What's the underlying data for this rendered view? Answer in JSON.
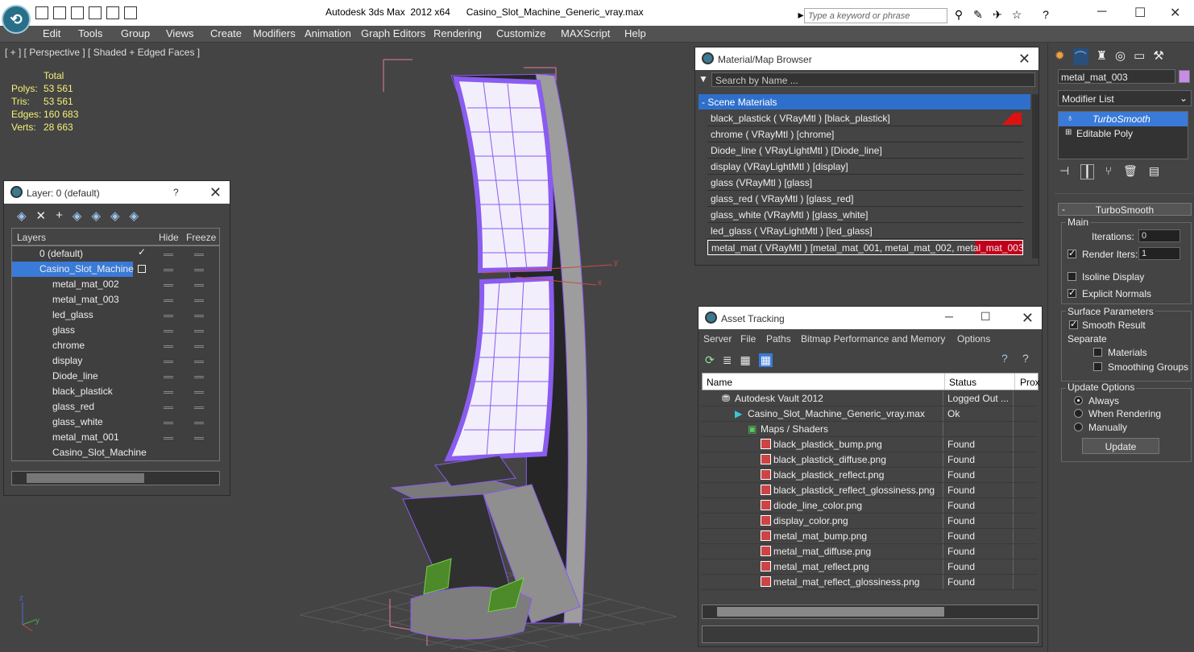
{
  "window": {
    "title": "Autodesk 3ds Max  2012 x64      Casino_Slot_Machine_Generic_vray.max",
    "search_placeholder": "Type a keyword or phrase",
    "logo": "3ds max logo-icon"
  },
  "menu": [
    "Edit",
    "Tools",
    "Group",
    "Views",
    "Create",
    "Modifiers",
    "Animation",
    "Graph Editors",
    "Rendering",
    "Customize",
    "MAXScript",
    "Help"
  ],
  "viewport": {
    "label": "[ + ] [ Perspective ] [ Shaded + Edged Faces ]",
    "stats": {
      "header": "Total",
      "rows": [
        {
          "k": "Polys:",
          "v": "53 561"
        },
        {
          "k": "Tris:",
          "v": "53 561"
        },
        {
          "k": "Edges:",
          "v": "160 683"
        },
        {
          "k": "Verts:",
          "v": "28 663"
        }
      ]
    },
    "axis_y": "y",
    "axis_x": "x",
    "gizmo_z": "z",
    "gizmo_y": "y"
  },
  "layer_panel": {
    "title": "Layer: 0 (default)",
    "help": "?",
    "columns": [
      "Layers",
      "Hide",
      "Freeze"
    ],
    "rows": [
      "0 (default)",
      "Casino_Slot_Machine",
      "metal_mat_002",
      "metal_mat_003",
      "led_glass",
      "glass",
      "chrome",
      "display",
      "Diode_line",
      "black_plastick",
      "glass_red",
      "glass_white",
      "metal_mat_001",
      "Casino_Slot_Machine"
    ]
  },
  "material_browser": {
    "title": "Material/Map Browser",
    "search": "Search by Name ...",
    "section": "- Scene Materials",
    "items": [
      "black_plastick  ( VRayMtl ) [black_plastick]",
      "chrome  ( VRayMtl ) [chrome]",
      "Diode_line  ( VRayLightMtl ) [Diode_line]",
      "display  (VRayLightMtl ) [display]",
      "glass  (VRayMtl ) [glass]",
      "glass_red  ( VRayMtl ) [glass_red]",
      "glass_white  (VRayMtl ) [glass_white]",
      "led_glass  ( VRayLightMtl ) [led_glass]",
      "metal_mat  ( VRayMtl ) [metal_mat_001, metal_mat_002, metal_mat_003]"
    ]
  },
  "asset_tracking": {
    "title": "Asset Tracking",
    "menu": [
      "Server",
      "File",
      "Paths",
      "Bitmap Performance and Memory",
      "Options"
    ],
    "columns": [
      "Name",
      "Status",
      "Prox"
    ],
    "rows": [
      {
        "name": "Autodesk Vault 2012",
        "status": "Logged Out ...",
        "indent": 0
      },
      {
        "name": "Casino_Slot_Machine_Generic_vray.max",
        "status": "Ok",
        "indent": 1
      },
      {
        "name": "Maps / Shaders",
        "status": "",
        "indent": 2
      },
      {
        "name": "black_plastick_bump.png",
        "status": "Found",
        "indent": 3
      },
      {
        "name": "black_plastick_diffuse.png",
        "status": "Found",
        "indent": 3
      },
      {
        "name": "black_plastick_reflect.png",
        "status": "Found",
        "indent": 3
      },
      {
        "name": "black_plastick_reflect_glossiness.png",
        "status": "Found",
        "indent": 3
      },
      {
        "name": "diode_line_color.png",
        "status": "Found",
        "indent": 3
      },
      {
        "name": "display_color.png",
        "status": "Found",
        "indent": 3
      },
      {
        "name": "metal_mat_bump.png",
        "status": "Found",
        "indent": 3
      },
      {
        "name": "metal_mat_diffuse.png",
        "status": "Found",
        "indent": 3
      },
      {
        "name": "metal_mat_reflect.png",
        "status": "Found",
        "indent": 3
      },
      {
        "name": "metal_mat_reflect_glossiness.png",
        "status": "Found",
        "indent": 3
      }
    ]
  },
  "command_panel": {
    "object_name": "metal_mat_003",
    "modifier_list": "Modifier List",
    "stack": [
      "TurboSmooth",
      "Editable Poly"
    ],
    "rollout": "TurboSmooth",
    "main": "Main",
    "iterations_label": "Iterations:",
    "iterations": "0",
    "render_iters_label": "Render Iters:",
    "render_iters": "1",
    "isoline": "Isoline Display",
    "explicit": "Explicit Normals",
    "surface": "Surface Parameters",
    "smooth_result": "Smooth Result",
    "separate": "Separate",
    "materials": "Materials",
    "smoothing_groups": "Smoothing Groups",
    "update_options": "Update Options",
    "always": "Always",
    "when_rendering": "When Rendering",
    "manually": "Manually",
    "update_btn": "Update",
    "swatch_color": "#c88ce8"
  }
}
